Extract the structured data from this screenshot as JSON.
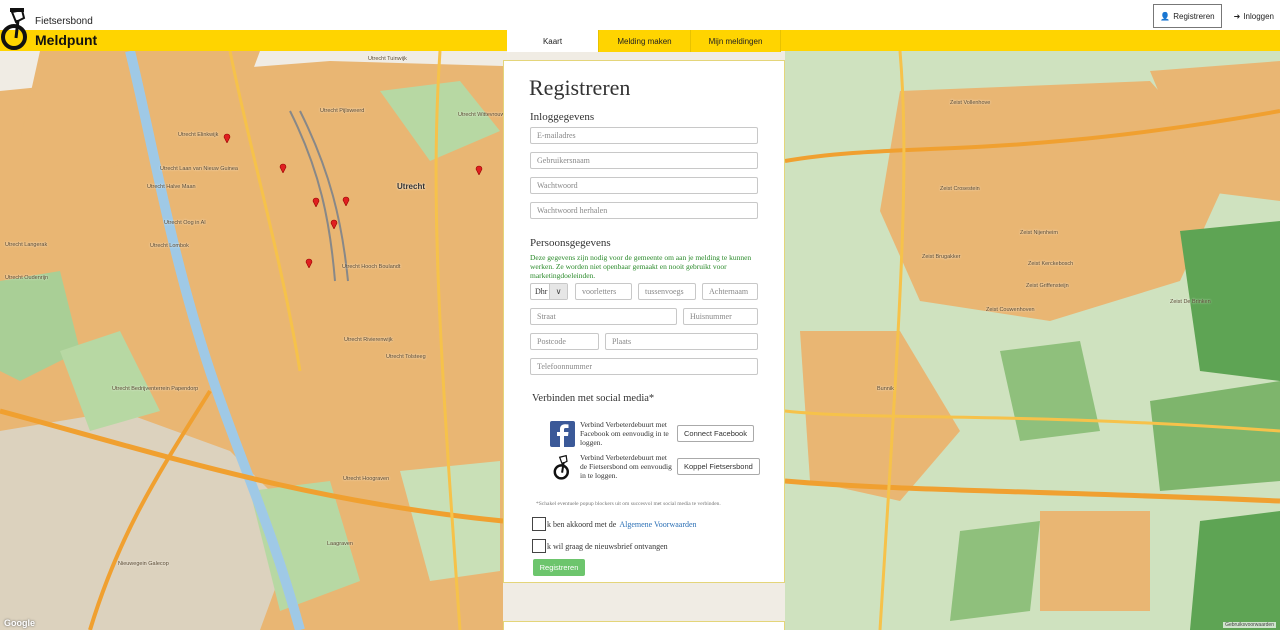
{
  "header": {
    "brand_top": "Fietsersbond",
    "brand_main": "Meldpunt",
    "register_button": "Registreren",
    "login_button": "Inloggen",
    "nav": [
      {
        "label": "Kaart",
        "active": true
      },
      {
        "label": "Melding maken",
        "active": false
      },
      {
        "label": "Mijn meldingen",
        "active": false
      }
    ]
  },
  "colors": {
    "brand_yellow": "#ffd400",
    "success_green": "#6dc56d",
    "info_green": "#2a8a2a",
    "link_blue": "#2a6fb5"
  },
  "form": {
    "title": "Registreren",
    "login_section": "Inloggegevens",
    "email_placeholder": "E-mailadres",
    "username_placeholder": "Gebruikersnaam",
    "password_placeholder": "Wachtwoord",
    "password_repeat_placeholder": "Wachtwoord herhalen",
    "personal_section": "Persoonsgegevens",
    "personal_info": "Deze gegevens zijn nodig voor de gemeente om aan je melding te kunnen werken. Ze worden niet openbaar gemaakt en nooit gebruikt voor marketingdoeleinden.",
    "salutation_value": "Dhr",
    "initials_placeholder": "voorletters",
    "infix_placeholder": "tussenvoegs",
    "lastname_placeholder": "Achternaam",
    "street_placeholder": "Straat",
    "housenumber_placeholder": "Huisnummer",
    "postcode_placeholder": "Postcode",
    "city_placeholder": "Plaats",
    "phone_placeholder": "Telefoonnummer",
    "social_section": "Verbinden met social media*",
    "facebook_text": "Verbind Verbeterdebuurt met Facebook om eenvoudig in te loggen.",
    "facebook_button": "Connect Facebook",
    "fietsersbond_text": "Verbind Verbeterdebuurt met de Fietsersbond om eenvoudig in te loggen.",
    "fietsersbond_button": "Koppel Fietsersbond",
    "popup_note": "*Schakel eventuele popup blockers uit om succesvol met social media te verbinden.",
    "terms_text": "k ben akkoord met de",
    "terms_link": "Algemene Voorwaarden",
    "newsletter_text": "k wil graag de nieuwsbrief ontvangen",
    "submit_button": "Registreren"
  },
  "map": {
    "city_label": "Utrecht",
    "google_label": "Google",
    "terms_label": "Gebruiksvoorwaarden",
    "labels": [
      {
        "text": "Utrecht Tuinwijk"
      },
      {
        "text": "Utrecht Pijlsweerd"
      },
      {
        "text": "Utrecht Wittevrouwen"
      },
      {
        "text": "Utrecht Elinkwijk"
      },
      {
        "text": "Utrecht Laan van Nieuw Guinea"
      },
      {
        "text": "Utrecht Halve Maan"
      },
      {
        "text": "Utrecht Oog in Al"
      },
      {
        "text": "Utrecht Lombok"
      },
      {
        "text": "Utrecht Langerak"
      },
      {
        "text": "Utrecht Oudenrijn"
      },
      {
        "text": "Utrecht Hooch Boulandt"
      },
      {
        "text": "Utrecht Rivierenwijk"
      },
      {
        "text": "Utrecht Tolsteeg"
      },
      {
        "text": "Utrecht Hoograven"
      },
      {
        "text": "Utrecht Bedrijventerrein Papendorp"
      },
      {
        "text": "Zeist Vollenhove"
      },
      {
        "text": "Zeist Crosestein"
      },
      {
        "text": "Zeist Nijenheim"
      },
      {
        "text": "Zeist Brugakker"
      },
      {
        "text": "Zeist Kerckebosch"
      },
      {
        "text": "Zeist Griffensteijn"
      },
      {
        "text": "Zeist Couwenhoven"
      },
      {
        "text": "Zeist De Brinken"
      },
      {
        "text": "Bunnik"
      },
      {
        "text": "Nieuwegein Galecop"
      },
      {
        "text": "Laagraven"
      }
    ],
    "markers": [
      {
        "name": "marker-1"
      },
      {
        "name": "marker-2"
      },
      {
        "name": "marker-3"
      },
      {
        "name": "marker-4"
      },
      {
        "name": "marker-5"
      },
      {
        "name": "marker-6"
      },
      {
        "name": "marker-7"
      }
    ]
  }
}
